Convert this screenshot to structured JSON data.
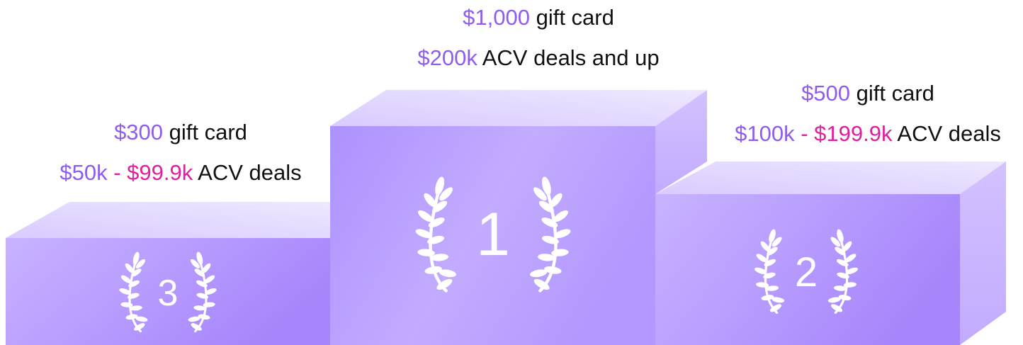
{
  "tiers": [
    {
      "rank": "1",
      "prize_amount": "$1,000",
      "prize_suffix": " gift card",
      "range_start": "$200k",
      "range_separator": "",
      "range_end": "",
      "range_suffix": " ACV deals and up"
    },
    {
      "rank": "2",
      "prize_amount": "$500",
      "prize_suffix": " gift card",
      "range_start": "$100k",
      "range_separator": " - ",
      "range_end": "$199.9k",
      "range_suffix": " ACV deals"
    },
    {
      "rank": "3",
      "prize_amount": "$300",
      "prize_suffix": " gift card",
      "range_start": "$50k",
      "range_separator": " - ",
      "range_end": "$99.9k",
      "range_suffix": " ACV deals"
    }
  ],
  "colors": {
    "accent_purple": "#8f5cf0",
    "accent_pink": "#e0209e",
    "podium_front": "#b79cff",
    "podium_top": "#e6dcff",
    "podium_side": "#cdb9ff"
  }
}
